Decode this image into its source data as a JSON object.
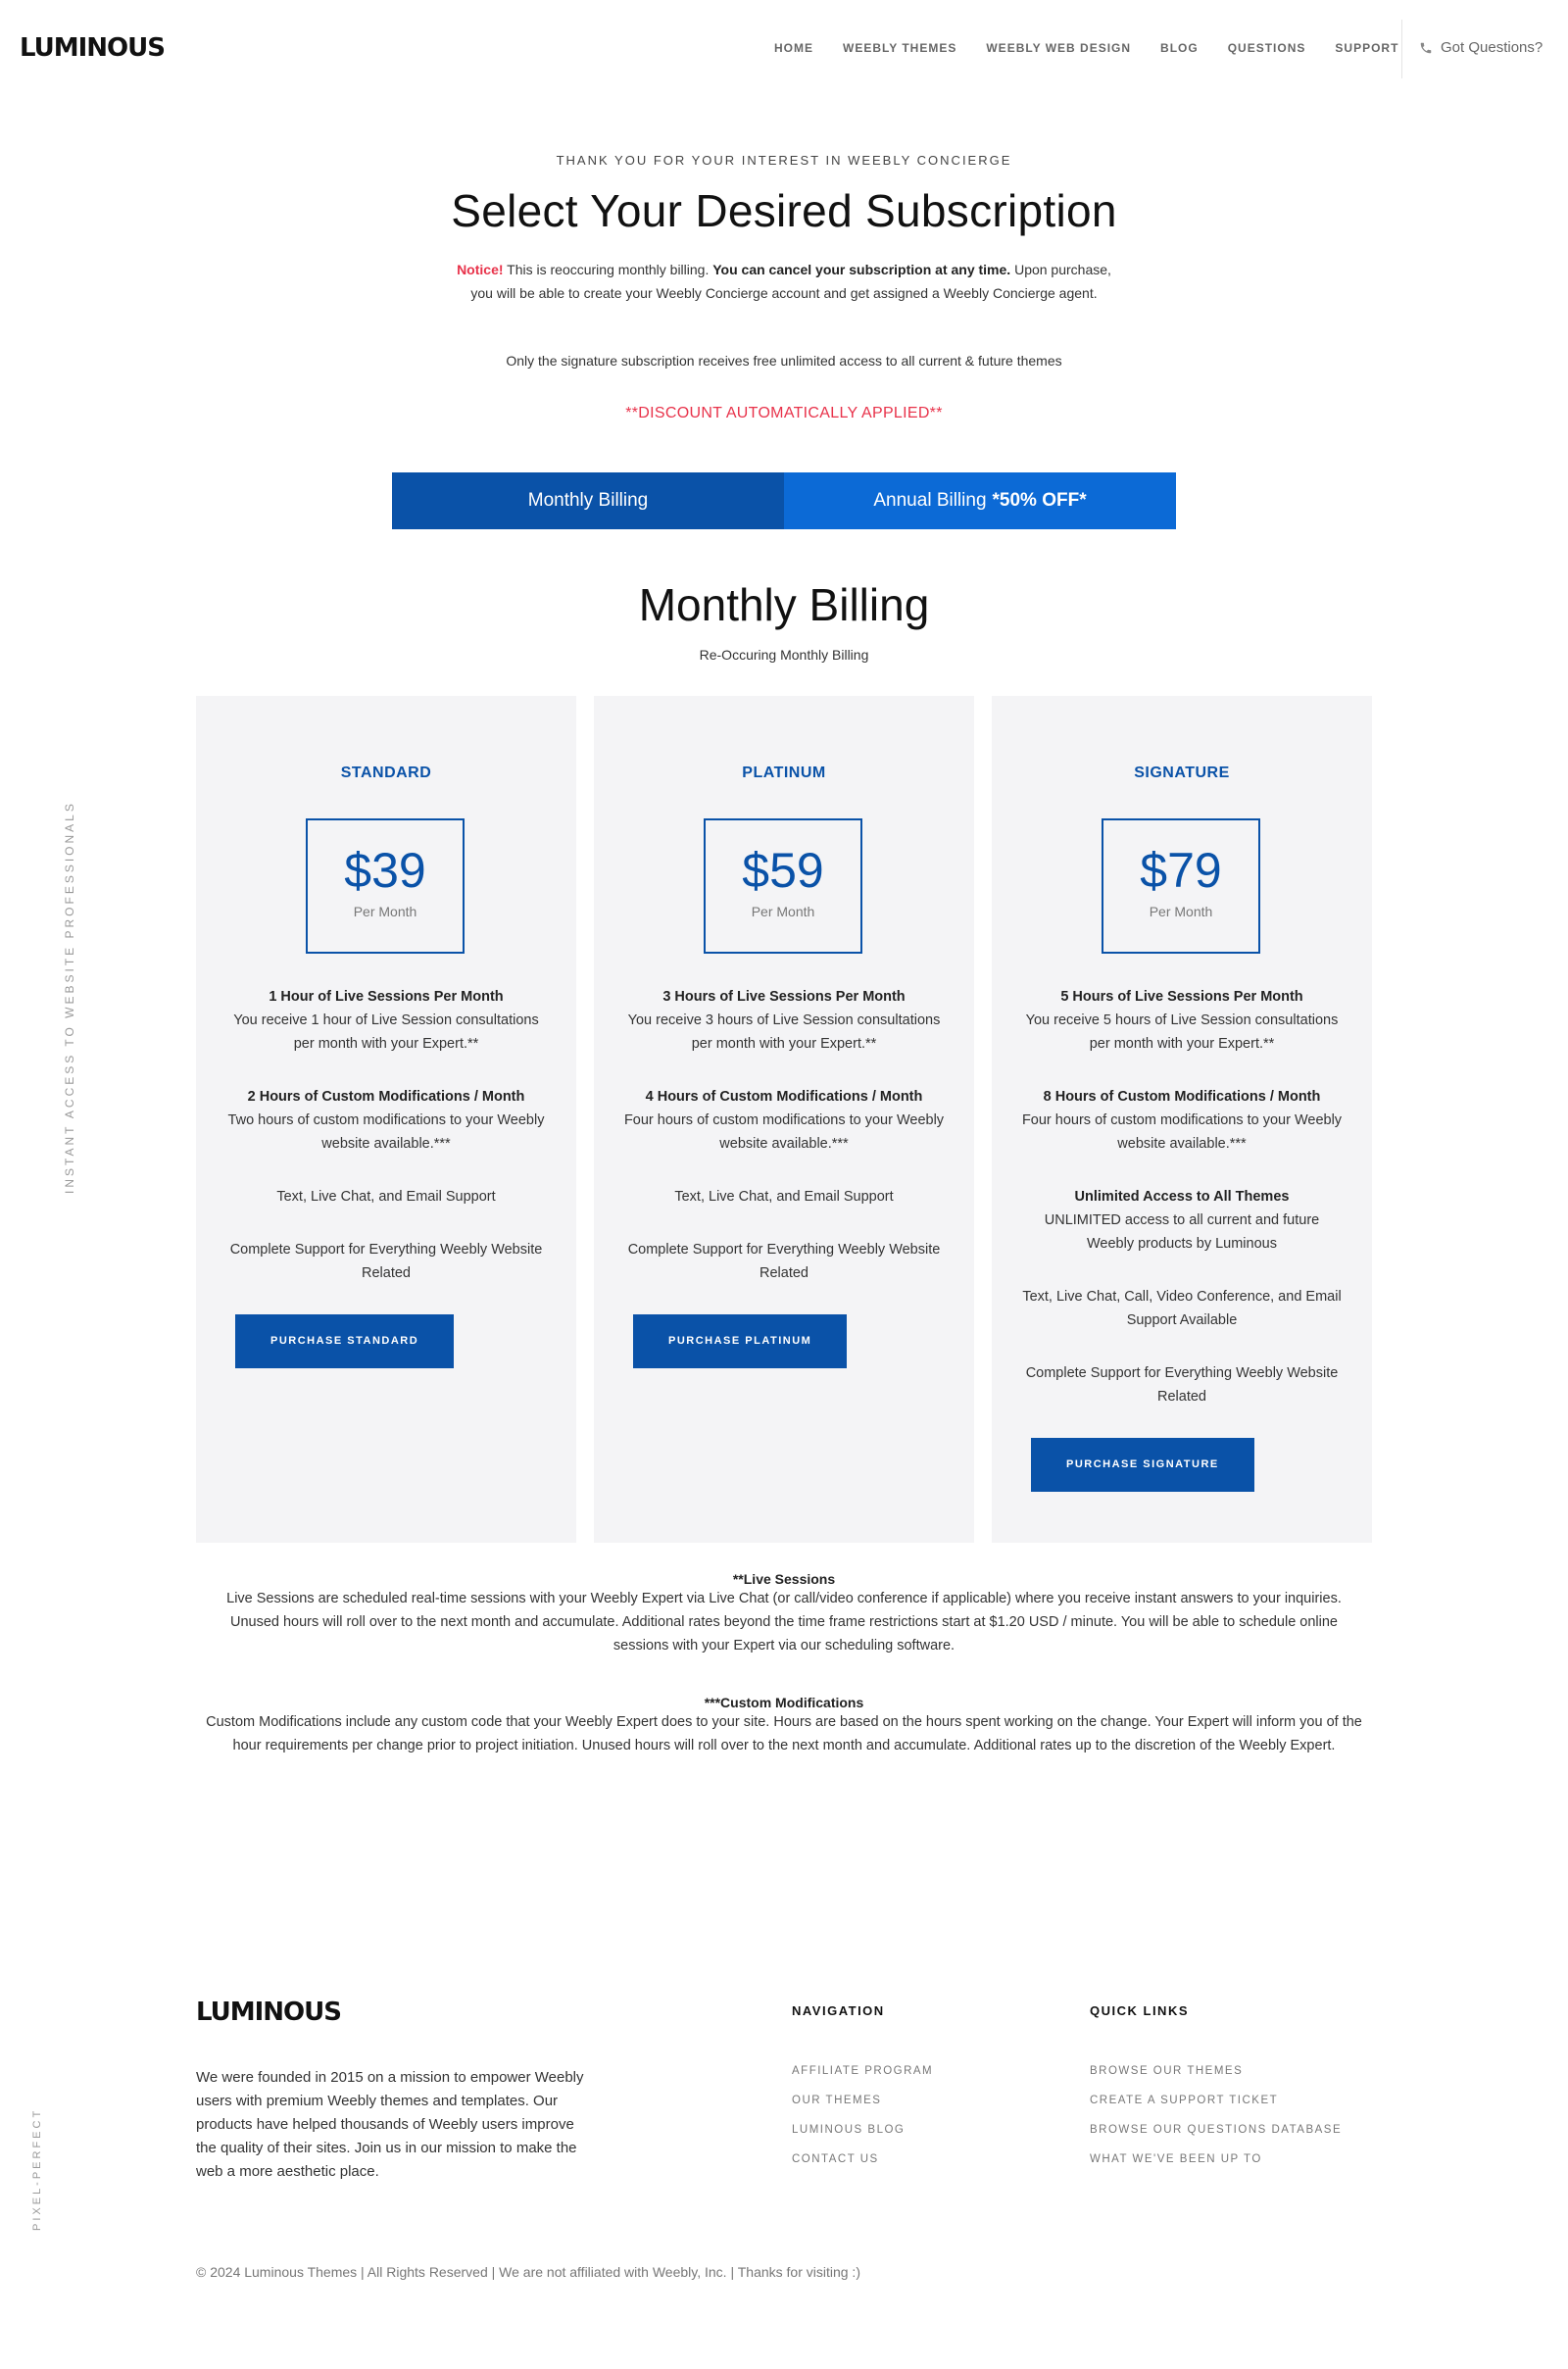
{
  "header": {
    "logo": "LUMINOUS",
    "nav": [
      "HOME",
      "WEEBLY THEMES",
      "WEEBLY WEB DESIGN",
      "BLOG",
      "QUESTIONS",
      "SUPPORT"
    ],
    "got_questions": "Got Questions?"
  },
  "side": {
    "left_vertical": "INSTANT ACCESS TO WEBSITE PROFESSIONALS",
    "bottom_vertical": "PIXEL-PERFECT"
  },
  "intro": {
    "kicker": "THANK YOU FOR YOUR INTEREST IN WEEBLY CONCIERGE",
    "title": "Select Your Desired Subscription",
    "notice_label": "Notice!",
    "notice_text1": "This is reoccuring monthly billing.",
    "notice_bold": "You can cancel your subscription at any time.",
    "notice_text2": "Upon purchase, you will be able to create your Weebly Concierge account and get assigned a Weebly Concierge agent.",
    "signature_note": "Only the signature subscription receives free unlimited access to all current & future themes",
    "discount": "**DISCOUNT AUTOMATICALLY APPLIED**"
  },
  "tabs": {
    "monthly": "Monthly Billing",
    "annual": "Annual Billing",
    "annual_badge": "*50% OFF*"
  },
  "section": {
    "title": "Monthly Billing",
    "subtitle": "Re-Occuring Monthly Billing"
  },
  "plans": [
    {
      "name": "STANDARD",
      "price": "$39",
      "per": "Per Month",
      "features": [
        {
          "title": "1 Hour of Live Sessions Per Month",
          "text": "You receive 1 hour of Live Session consultations per month with your Expert.**"
        },
        {
          "title": "2 Hours of Custom Modifications / Month",
          "text": "Two hours of custom modifications to your Weebly website available.***"
        },
        {
          "title": "",
          "text": "Text, Live Chat, and Email Support"
        },
        {
          "title": "",
          "text": "Complete Support for Everything Weebly Website Related"
        }
      ],
      "button": "PURCHASE STANDARD"
    },
    {
      "name": "PLATINUM",
      "price": "$59",
      "per": "Per Month",
      "features": [
        {
          "title": "3 Hours of Live Sessions Per Month",
          "text": "You receive 3 hours of Live Session consultations per month with your Expert.**"
        },
        {
          "title": "4 Hours of Custom Modifications / Month",
          "text": "Four hours of custom modifications to your Weebly website available.***"
        },
        {
          "title": "",
          "text": "Text, Live Chat, and Email Support"
        },
        {
          "title": "",
          "text": "Complete Support for Everything Weebly Website Related"
        }
      ],
      "button": "PURCHASE PLATINUM"
    },
    {
      "name": "SIGNATURE",
      "price": "$79",
      "per": "Per Month",
      "features": [
        {
          "title": "5 Hours of Live Sessions Per Month",
          "text": "You receive 5 hours of Live Session consultations per month with your Expert.**"
        },
        {
          "title": "8 Hours of Custom Modifications / Month",
          "text": "Four hours of custom modifications to your Weebly website available.***"
        },
        {
          "title": "Unlimited Access to All Themes",
          "text": "UNLIMITED access to all current and future Weebly products by Luminous"
        },
        {
          "title": "",
          "text": "Text, Live Chat, Call, Video Conference, and Email Support Available"
        },
        {
          "title": "",
          "text": "Complete Support for Everything Weebly Website Related"
        }
      ],
      "button": "PURCHASE SIGNATURE"
    }
  ],
  "footnotes": {
    "live_title": "**Live Sessions",
    "live_text": "Live Sessions are scheduled real-time sessions with your Weebly Expert via Live Chat (or call/video conference if applicable) where you receive instant answers to your inquiries. Unused hours will roll over to the next month and accumulate. Additional rates beyond the time frame restrictions start at $1.20 USD / minute. You will be able to schedule online sessions with your Expert via our scheduling software.",
    "custom_title": "***Custom Modifications",
    "custom_text": "Custom Modifications include any custom code that your Weebly Expert does to your site. Hours are based on the hours spent working on the change. Your Expert will inform you of the hour requirements per change prior to project initiation. Unused hours will roll over to the next month and accumulate. Additional rates up to the discretion of the Weebly Expert."
  },
  "footer": {
    "logo": "LUMINOUS",
    "about": "We were founded in 2015 on a mission to empower Weebly users with premium Weebly themes and templates. Our products have helped thousands of Weebly users improve the quality of their sites. Join us in our mission to make the web a more aesthetic place.",
    "nav_head": "NAVIGATION",
    "nav_links": [
      "AFFILIATE PROGRAM",
      "OUR THEMES",
      "LUMINOUS BLOG",
      "CONTACT US"
    ],
    "quick_head": "QUICK LINKS",
    "quick_links": [
      "BROWSE OUR THEMES",
      "CREATE A SUPPORT TICKET",
      "BROWSE OUR QUESTIONS DATABASE",
      "WHAT WE'VE BEEN UP TO"
    ],
    "copyright": "© 2024 Luminous Themes | All Rights Reserved | We are not affiliated with Weebly, Inc. | Thanks for visiting :)"
  },
  "colors": {
    "brand_blue": "#0a52a8",
    "tab_blue": "#0c6ad6",
    "alert_red": "#e8324a",
    "card_bg": "#f4f4f6"
  },
  "icons": {
    "got_questions": "phone-icon"
  }
}
